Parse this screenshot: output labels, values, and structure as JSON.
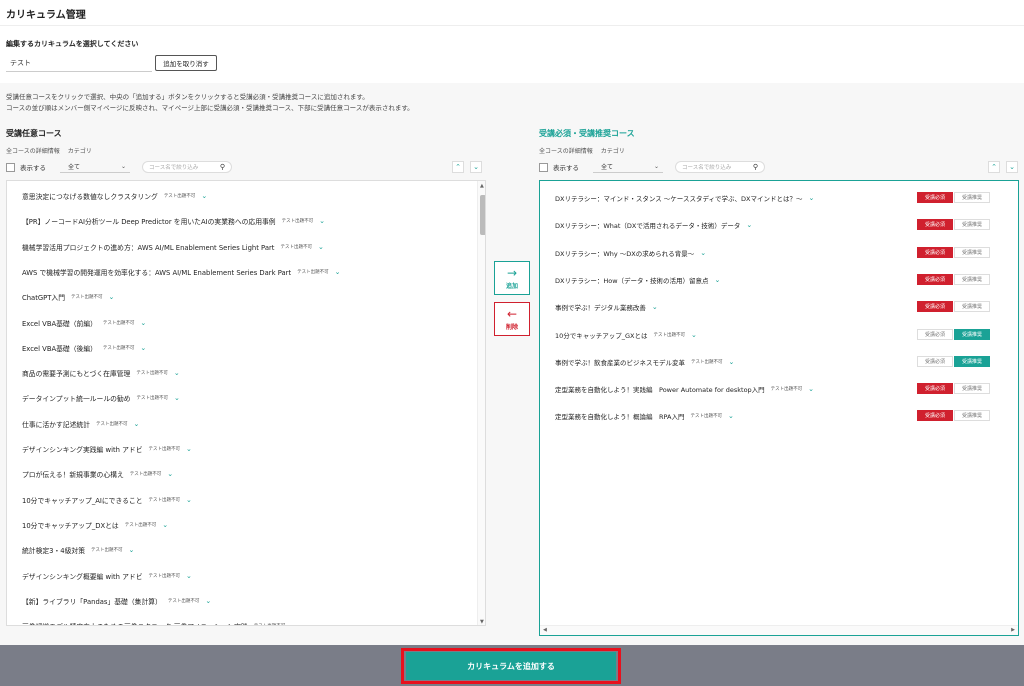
{
  "header": {
    "title": "カリキュラム管理"
  },
  "selector": {
    "label": "編集するカリキュラムを選択してください",
    "input_value": "テスト",
    "undo_label": "追加を取り消す"
  },
  "description": {
    "line1": "受講任意コースをクリックで選択、中央の「追加する」ボタンをクリックすると受講必須・受講推奨コースに追加されます。",
    "line2": "コースの並び順はメンバー側マイページに反映され、マイページ上部に受講必須・受講推奨コース、下部に受講任意コースが表示されます。"
  },
  "left": {
    "title": "受講任意コース",
    "links": [
      "全コースの詳細情報",
      "カテゴリ"
    ],
    "show_label": "表示する",
    "select_value": "全て",
    "search_placeholder": "コース名で絞り込み",
    "items": [
      {
        "name": "意思決定につなげる数値なしクラスタリング",
        "tag": "テスト出題不可"
      },
      {
        "name": "【PR】ノーコードAI分析ツール Deep Predictor を用いたAIの実業務への応用事例",
        "tag": "テスト出題不可"
      },
      {
        "name": "機械学習活用プロジェクトの進め方：AWS AI/ML Enablement Series Light Part",
        "tag": "テスト出題不可"
      },
      {
        "name": "AWS で機械学習の開発運用を効率化する：AWS AI/ML Enablement Series Dark Part",
        "tag": "テスト出題不可"
      },
      {
        "name": "ChatGPT入門",
        "tag": "テスト出題不可"
      },
      {
        "name": "Excel VBA基礎（前編）",
        "tag": "テスト出題不可"
      },
      {
        "name": "Excel VBA基礎（後編）",
        "tag": "テスト出題不可"
      },
      {
        "name": "商品の需要予測にもとづく在庫管理",
        "tag": "テスト出題不可"
      },
      {
        "name": "データインプット統一ルールの勧め",
        "tag": "テスト出題不可"
      },
      {
        "name": "仕事に活かす記述統計",
        "tag": "テスト出題不可"
      },
      {
        "name": "デザインシンキング実践編 with アドビ",
        "tag": "テスト出題不可"
      },
      {
        "name": "プロが伝える！新規事業の心構え",
        "tag": "テスト出題不可"
      },
      {
        "name": "10分でキャッチアップ_AIにできること",
        "tag": "テスト出題不可"
      },
      {
        "name": "10分でキャッチアップ_DXとは",
        "tag": "テスト出題不可"
      },
      {
        "name": "統計検定3・4級対策",
        "tag": "テスト出題不可"
      },
      {
        "name": "デザインシンキング概要編 with アドビ",
        "tag": "テスト出題不可"
      },
      {
        "name": "【新】ライブラリ「Pandas」基礎（集計算）",
        "tag": "テスト出題不可"
      },
      {
        "name": "画像認識モデル精度向上のための画像テクニック 画像アノテーション実践",
        "tag": "テスト出題不可"
      }
    ]
  },
  "middle": {
    "add_label": "追加",
    "delete_label": "削除",
    "add_icon": "arrow-right-icon",
    "delete_icon": "arrow-left-icon"
  },
  "right": {
    "title": "受講必須・受講推奨コース",
    "links": [
      "全コースの詳細情報",
      "カテゴリ"
    ],
    "show_label": "表示する",
    "select_value": "全て",
    "search_placeholder": "コース名で絞り込み",
    "required_label": "受講必須",
    "recommended_label": "受講推奨",
    "items": [
      {
        "name": "DXリテラシー：マインド・スタンス ～ケーススタディで学ぶ、DXマインドとは？～",
        "tag": "",
        "state": "required"
      },
      {
        "name": "DXリテラシー：What（DXで活用されるデータ・技術）データ",
        "tag": "",
        "state": "required"
      },
      {
        "name": "DXリテラシー：Why ～DXの求められる背景～",
        "tag": "",
        "state": "required"
      },
      {
        "name": "DXリテラシー：How（データ・技術の活用）留意点",
        "tag": "",
        "state": "required"
      },
      {
        "name": "事例で学ぶ！デジタル業務改善",
        "tag": "",
        "state": "required"
      },
      {
        "name": "10分でキャッチアップ_GXとは",
        "tag": "テスト出題不可",
        "state": "recommended"
      },
      {
        "name": "事例で学ぶ！飲食産業のビジネスモデル変革",
        "tag": "テスト出題不可",
        "state": "recommended"
      },
      {
        "name": "定型業務を自動化しよう！実践編　Power Automate for desktop入門",
        "tag": "テスト出題不可",
        "state": "required"
      },
      {
        "name": "定型業務を自動化しよう！概論編　RPA入門",
        "tag": "テスト出題不可",
        "state": "required"
      }
    ]
  },
  "footer": {
    "submit_label": "カリキュラムを追加する"
  },
  "colors": {
    "accent": "#1aa296",
    "danger": "#d0202e",
    "footer_bg": "#7a7d88"
  }
}
